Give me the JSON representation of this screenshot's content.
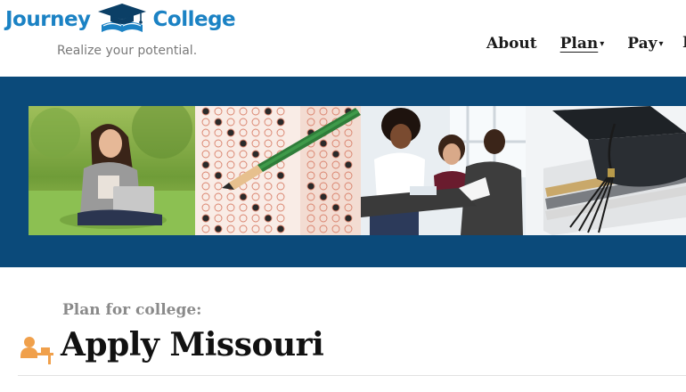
{
  "logo": {
    "word_left": "Journey",
    "word_right": "College",
    "icon": "graduation-cap-book-icon",
    "brand_color": "#1b82c4"
  },
  "tagline": "Realize your potential.",
  "nav": {
    "items": [
      {
        "label": "About",
        "dropdown": false,
        "active": false
      },
      {
        "label": "Plan",
        "dropdown": true,
        "active": true
      },
      {
        "label": "Pay",
        "dropdown": true,
        "active": false
      }
    ]
  },
  "banner": {
    "background": "#0b4a7a",
    "photos": [
      "student-with-laptop-photo",
      "answer-sheet-pencil-photo",
      "students-studying-photo",
      "graduation-cap-books-photo"
    ]
  },
  "content": {
    "section_label": "Plan for college:",
    "title": "Apply Missouri",
    "title_icon": "student-at-desk-icon",
    "accent": "#f0a04b"
  }
}
